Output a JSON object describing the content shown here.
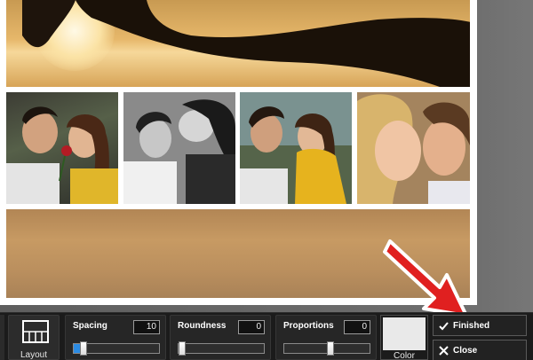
{
  "toolbar": {
    "layout_label": "Layout",
    "spacing": {
      "label": "Spacing",
      "value": "10",
      "level": 0.07
    },
    "roundness": {
      "label": "Roundness",
      "value": "0",
      "level": 0.0
    },
    "proportions": {
      "label": "Proportions",
      "value": "0",
      "level": 0.5
    },
    "color_label": "Color",
    "color_value": "#e9e9e9",
    "finished_label": "Finished",
    "close_label": "Close"
  },
  "collage": {
    "photo_count": 6
  },
  "icons": {
    "layout": "grid-layout-icon",
    "finished": "checkmark-icon",
    "close": "x-icon",
    "annotation": "red-arrow-icon"
  },
  "colors": {
    "accent": "#2b8be3",
    "arrow": "#e02020",
    "toolbar": "#1b1b1b"
  }
}
